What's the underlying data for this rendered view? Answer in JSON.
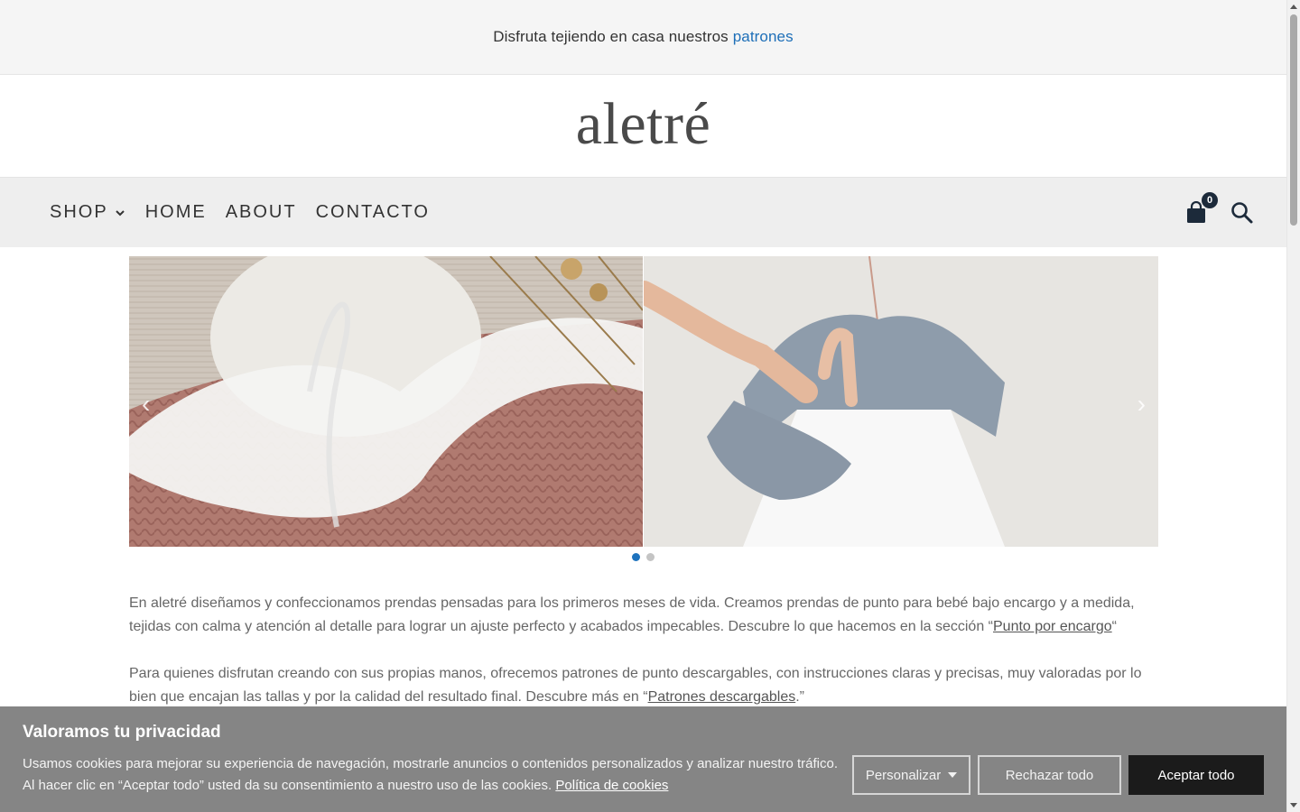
{
  "topbar": {
    "text": "Disfruta tejiendo en casa nuestros",
    "link": "patrones"
  },
  "logo": "aletré",
  "nav": {
    "items": [
      {
        "label": "SHOP"
      },
      {
        "label": "HOME"
      },
      {
        "label": "ABOUT"
      },
      {
        "label": "CONTACTO"
      }
    ],
    "cart_count": "0"
  },
  "slider": {
    "slides": [
      "knit-sweater-with-lace-collar",
      "grey-knit-dress-with-booties"
    ],
    "active_index": 0,
    "dot_count": 2
  },
  "content": {
    "p1_text": "En aletré diseñamos y confeccionamos prendas pensadas para los primeros meses de vida. Creamos prendas de punto para bebé bajo encargo y a medida, tejidas con calma y atención al detalle para lograr un ajuste perfecto y acabados impecables. Descubre lo que hacemos en la sección “",
    "p1_link": "Punto por encargo",
    "p1_end": "“",
    "p2_text": "Para quienes disfrutan creando con sus propias manos, ofrecemos patrones de punto descargables, con instrucciones claras y precisas, muy valoradas por lo bien que encajan las tallas y por la calidad del resultado final. Descubre más en “",
    "p2_link": "Patrones descargables",
    "p2_end": ".”"
  },
  "cookie": {
    "title": "Valoramos tu privacidad",
    "text": "Usamos cookies para mejorar su experiencia de navegación, mostrarle anuncios o contenidos personalizados y analizar nuestro tráfico. Al hacer clic en “Aceptar todo” usted da su consentimiento a nuestro uso de las cookies.",
    "policy_link": "Política de cookies",
    "customize_label": "Personalizar",
    "reject_label": "Rechazar todo",
    "accept_label": "Aceptar todo"
  },
  "colors": {
    "link": "#1e6fb8",
    "accept_button": "#1b1b1b",
    "cookie_bg": "#858585",
    "nav_bg": "#eeeeee"
  }
}
